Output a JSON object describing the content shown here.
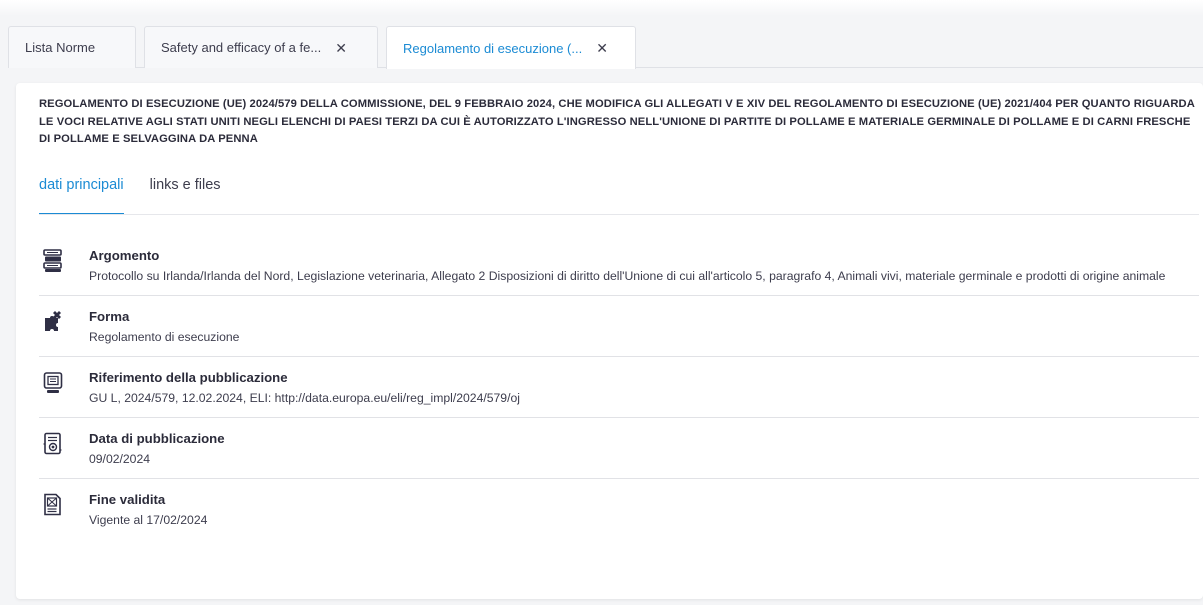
{
  "tabs": [
    {
      "label": "Lista Norme",
      "closable": false
    },
    {
      "label": "Safety and efficacy of a fe...",
      "closable": true
    },
    {
      "label": "Regolamento di esecuzione (...",
      "closable": true,
      "active": true
    }
  ],
  "close_glyph": "✕",
  "document": {
    "title": "REGOLAMENTO DI ESECUZIONE (UE) 2024/579 DELLA COMMISSIONE, DEL 9 FEBBRAIO 2024, CHE MODIFICA GLI ALLEGATI V E XIV DEL REGOLAMENTO DI ESECUZIONE (UE) 2021/404 PER QUANTO RIGUARDA LE VOCI RELATIVE AGLI STATI UNITI NEGLI ELENCHI DI PAESI TERZI DA CUI È AUTORIZZATO L'INGRESSO NELL'UNIONE DI PARTITE DI POLLAME E MATERIALE GERMINALE DI POLLAME E DI CARNI FRESCHE DI POLLAME E SELVAGGINA DA PENNA"
  },
  "subtabs": [
    {
      "label": "dati principali",
      "active": true
    },
    {
      "label": "links e files",
      "active": false
    }
  ],
  "fields": [
    {
      "icon": "books-stack-icon",
      "label": "Argomento",
      "value": "Protocollo su Irlanda/Irlanda del Nord, Legislazione veterinaria, Allegato 2 Disposizioni di diritto dell'Unione di cui all'articolo 5, paragrafo 4, Animali vivi, materiale germinale e prodotti di origine animale"
    },
    {
      "icon": "puzzle-icon",
      "label": "Forma",
      "value": "Regolamento di esecuzione"
    },
    {
      "icon": "publication-monitor-icon",
      "label": "Riferimento della pubblicazione",
      "value": "GU L, 2024/579, 12.02.2024, ELI: http://data.europa.eu/eli/reg_impl/2024/579/oj"
    },
    {
      "icon": "certificate-icon",
      "label": "Data di pubblicazione",
      "value": "09/02/2024"
    },
    {
      "icon": "expired-document-icon",
      "label": "Fine validita",
      "value": "Vigente al 17/02/2024"
    }
  ],
  "colors": {
    "accent": "#1b8bd4",
    "text": "#2b2b3a",
    "icon": "#2f2f45",
    "background": "#f4f5f7"
  }
}
